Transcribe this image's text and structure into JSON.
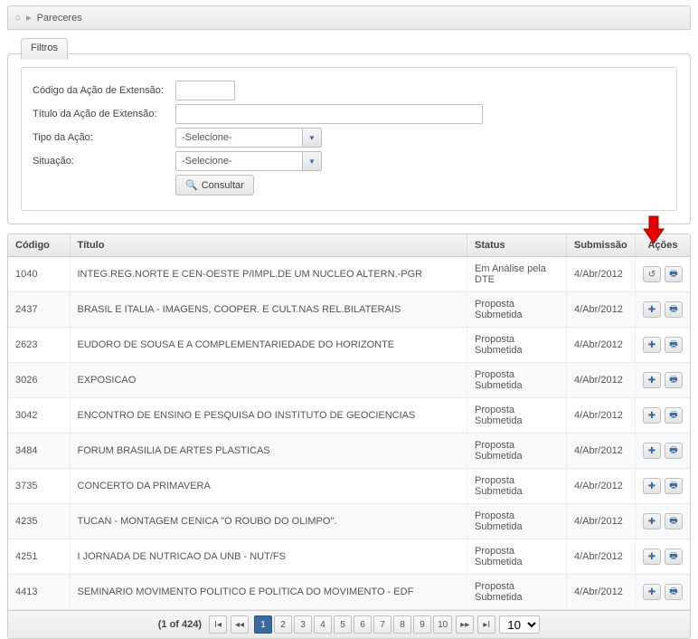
{
  "breadcrumb": {
    "title": "Pareceres"
  },
  "filters": {
    "tab_label": "Filtros",
    "codigo_label": "Código da Ação de Extensão:",
    "titulo_label": "Título da Ação de Extensão:",
    "tipo_label": "Tipo da Ação:",
    "situacao_label": "Situação:",
    "tipo_value": "-Selecione-",
    "situacao_value": "-Selecione-",
    "consultar_label": "Consultar"
  },
  "table": {
    "headers": {
      "codigo": "Código",
      "titulo": "Título",
      "status": "Status",
      "submissao": "Submissão",
      "acoes": "Ações"
    },
    "rows": [
      {
        "codigo": "1040",
        "titulo": "INTEG.REG.NORTE E CEN-OESTE P/IMPL.DE UM NUCLEO ALTERN.-PGR",
        "status": "Em Análise pela DTE",
        "submissao": "4/Abr/2012",
        "alt": true
      },
      {
        "codigo": "2437",
        "titulo": "BRASIL E ITALIA - IMAGENS, COOPER. E CULT.NAS REL.BILATERAIS",
        "status": "Proposta Submetida",
        "submissao": "4/Abr/2012"
      },
      {
        "codigo": "2623",
        "titulo": "EUDORO DE SOUSA E A COMPLEMENTARIEDADE DO HORIZONTE",
        "status": "Proposta Submetida",
        "submissao": "4/Abr/2012"
      },
      {
        "codigo": "3026",
        "titulo": "EXPOSICAO",
        "status": "Proposta Submetida",
        "submissao": "4/Abr/2012"
      },
      {
        "codigo": "3042",
        "titulo": "ENCONTRO DE ENSINO E PESQUISA DO INSTITUTO DE GEOCIENCIAS",
        "status": "Proposta Submetida",
        "submissao": "4/Abr/2012"
      },
      {
        "codigo": "3484",
        "titulo": "FORUM BRASILIA DE ARTES PLASTICAS",
        "status": "Proposta Submetida",
        "submissao": "4/Abr/2012"
      },
      {
        "codigo": "3735",
        "titulo": "CONCERTO DA PRIMAVERA",
        "status": "Proposta Submetida",
        "submissao": "4/Abr/2012"
      },
      {
        "codigo": "4235",
        "titulo": "TUCAN - MONTAGEM CENICA \"O ROUBO DO OLIMPO\".",
        "status": "Proposta Submetida",
        "submissao": "4/Abr/2012"
      },
      {
        "codigo": "4251",
        "titulo": "I JORNADA DE NUTRICAO DA UNB - NUT/FS",
        "status": "Proposta Submetida",
        "submissao": "4/Abr/2012"
      },
      {
        "codigo": "4413",
        "titulo": "SEMINARIO MOVIMENTO POLITICO E POLITICA DO MOVIMENTO - EDF",
        "status": "Proposta Submetida",
        "submissao": "4/Abr/2012"
      }
    ]
  },
  "paginator": {
    "info": "(1 of 424)",
    "pages": [
      "1",
      "2",
      "3",
      "4",
      "5",
      "6",
      "7",
      "8",
      "9",
      "10"
    ],
    "page_size": "10",
    "first": "⏮",
    "prev": "◀◀",
    "next": "▶▶",
    "last": "⏭"
  }
}
